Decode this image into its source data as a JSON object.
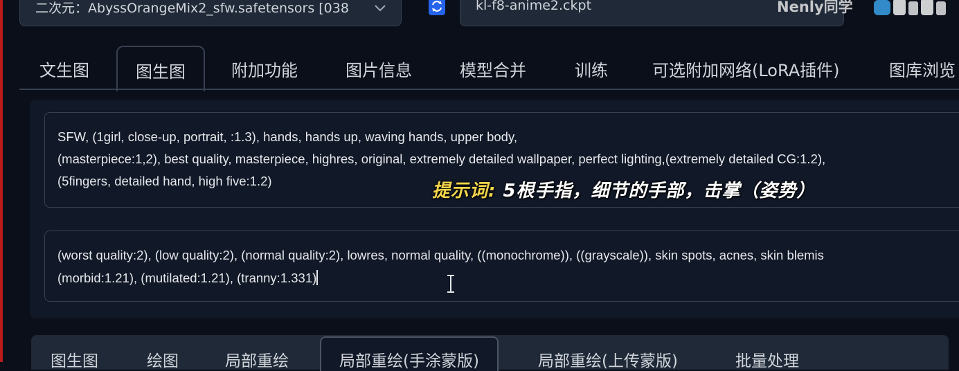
{
  "model_bar": {
    "checkpoint_value": "二次元：AbyssOrangeMix2_sfw.safetensors [038",
    "vae_value": "kl-f8-anime2.ckpt"
  },
  "watermark": {
    "text": "Nenly同学"
  },
  "tabs": [
    {
      "label": "文生图",
      "active": false
    },
    {
      "label": "图生图",
      "active": true
    },
    {
      "label": "附加功能",
      "active": false
    },
    {
      "label": "图片信息",
      "active": false
    },
    {
      "label": "模型合并",
      "active": false
    },
    {
      "label": "训练",
      "active": false
    },
    {
      "label": "可选附加网络(LoRA插件)",
      "active": false
    },
    {
      "label": "图库浏览",
      "active": false
    }
  ],
  "prompt": {
    "lines": [
      "SFW, (1girl, close-up, portrait, :1.3), hands, hands up, waving hands, upper body,",
      "(masterpiece:1,2), best quality, masterpiece, highres, original, extremely detailed wallpaper, perfect lighting,(extremely detailed CG:1.2),",
      "(5fingers, detailed hand, high five:1.2)"
    ]
  },
  "negative_prompt": {
    "lines": [
      "(worst quality:2), (low quality:2), (normal quality:2), lowres, normal quality, ((monochrome)), ((grayscale)), skin spots, acnes, skin blemis",
      "(morbid:1.21), (mutilated:1.21), (tranny:1.331)"
    ]
  },
  "subtitle": {
    "label": "提示词:",
    "text": "5根手指，细节的手部，击掌（姿势）"
  },
  "subtabs": [
    {
      "label": "图生图",
      "active": false
    },
    {
      "label": "绘图",
      "active": false
    },
    {
      "label": "局部重绘",
      "active": false
    },
    {
      "label": "局部重绘(手涂蒙版)",
      "active": true
    },
    {
      "label": "局部重绘(上传蒙版)",
      "active": false
    },
    {
      "label": "批量处理",
      "active": false
    }
  ],
  "colors": {
    "background": "#0b0f19",
    "accent": "#2563eb",
    "subtitle_highlight": "#f5d54a"
  }
}
